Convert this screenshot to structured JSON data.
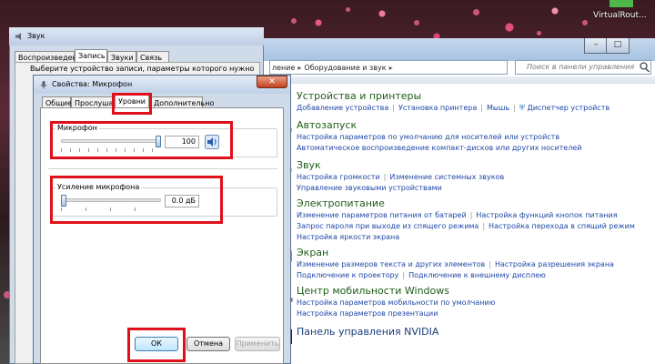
{
  "desktop": {
    "corner_label": "VirtualRout..."
  },
  "control_panel": {
    "address": [
      "ление",
      "Оборудование и звук"
    ],
    "search_placeholder": "Поиск в панели управления",
    "categories": [
      {
        "title": "Устройства и принтеры",
        "icon": "printer-icon",
        "color": "#1f5e18",
        "lines": [
          [
            "Добавление устройства",
            "Установка принтера",
            "Мышь",
            "Диспетчер устройств"
          ]
        ]
      },
      {
        "title": "Автозапуск",
        "icon": "autoplay-icon",
        "color": "#1f5e18",
        "lines": [
          [
            "Настройка параметров по умолчанию для носителей или устройств"
          ],
          [
            "Автоматическое воспроизведение компакт-дисков или других носителей"
          ]
        ]
      },
      {
        "title": "Звук",
        "icon": "speaker-icon",
        "color": "#1f5e18",
        "lines": [
          [
            "Настройка громкости",
            "Изменение системных звуков"
          ],
          [
            "Управление звуковыми устройствами"
          ]
        ]
      },
      {
        "title": "Электропитание",
        "icon": "power-icon",
        "color": "#1f5e18",
        "lines": [
          [
            "Изменение параметров питания от батарей",
            "Настройка функций кнопок питания"
          ],
          [
            "Запрос пароля при выходе из спящего режима",
            "Настройка перехода в спящий режим"
          ],
          [
            "Настройка яркости экрана"
          ]
        ]
      },
      {
        "title": "Экран",
        "icon": "display-icon",
        "color": "#1f5e18",
        "lines": [
          [
            "Изменение размеров текста и других элементов",
            "Настройка разрешения экрана"
          ],
          [
            "Подключение к проектору",
            "Подключение к внешнему дисплею"
          ]
        ]
      },
      {
        "title": "Центр мобильности Windows",
        "icon": "mobility-icon",
        "color": "#1f5e18",
        "lines": [
          [
            "Настройка параметров мобильности по умолчанию"
          ],
          [
            "Настройка параметров презентации"
          ]
        ]
      },
      {
        "title": "Панель управления NVIDIA",
        "icon": "nvidia-icon",
        "color": "#1a3e7a",
        "lines": []
      }
    ]
  },
  "sound_window": {
    "title": "Звук",
    "tabs": [
      "Воспроизведение",
      "Запись",
      "Звуки",
      "Связь"
    ],
    "active_tab": "Запись",
    "description": "Выберите устройство записи, параметры которого нужно"
  },
  "properties_dialog": {
    "title": "Свойства: Микрофон",
    "close_label": "✕",
    "tabs": [
      "Общие",
      "Прослушать",
      "Уровни",
      "Дополнительно"
    ],
    "active_tab": "Уровни",
    "mic_group_label": "Микрофон",
    "mic_level": 100,
    "mic_value_text": "100",
    "boost_group_label": "Усиление микрофона",
    "boost_level": 0,
    "boost_value_text": "0.0 дБ",
    "ok_label": "ОК",
    "cancel_label": "Отмена",
    "apply_label": "Применить"
  },
  "highlight_color": "#e0101a"
}
